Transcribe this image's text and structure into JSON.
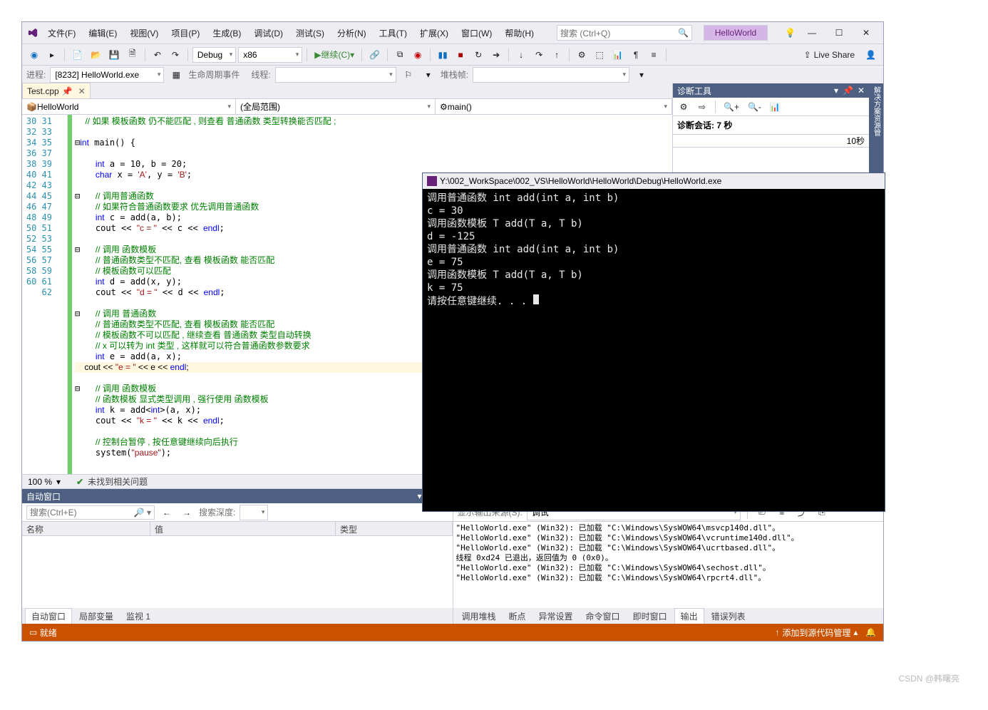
{
  "title": {
    "solution": "HelloWorld"
  },
  "menu": {
    "file": "文件(F)",
    "edit": "编辑(E)",
    "view": "视图(V)",
    "project": "项目(P)",
    "build": "生成(B)",
    "debug": "调试(D)",
    "test": "测试(S)",
    "analyze": "分析(N)",
    "tools": "工具(T)",
    "extensions": "扩展(X)",
    "window": "窗口(W)",
    "help": "帮助(H)"
  },
  "search": {
    "placeholder": "搜索 (Ctrl+Q)"
  },
  "toolbar": {
    "config": "Debug",
    "platform": "x86",
    "continue": "继续(C)",
    "liveshare": "Live Share"
  },
  "toolbar2": {
    "process_lbl": "进程:",
    "process_val": "[8232] HelloWorld.exe",
    "lifecycle": "生命周期事件",
    "thread": "线程:",
    "stackframe": "堆栈帧:"
  },
  "file_tab": "Test.cpp",
  "nav": {
    "project": "HelloWorld",
    "scope": "(全局范围)",
    "func": "main()"
  },
  "gutter": {
    "start": 30,
    "end": 62
  },
  "zoom": {
    "value": "100 %",
    "issues": "未找到相关问题"
  },
  "diag": {
    "title": "诊断工具",
    "session": "诊断会话: 7 秒",
    "tick": "10秒"
  },
  "rightvert": "解决方案资源管",
  "auto": {
    "title": "自动窗口",
    "search_ph": "搜索(Ctrl+E)",
    "depth_lbl": "搜索深度:",
    "col_name": "名称",
    "col_val": "值",
    "col_type": "类型"
  },
  "auto_tabs": {
    "auto": "自动窗口",
    "locals": "局部变量",
    "watch": "监视 1"
  },
  "output": {
    "title": "输出",
    "src_lbl": "显示输出来源(S):",
    "src_val": "调试",
    "lines": [
      "\"HelloWorld.exe\" (Win32): 已加载 \"C:\\Windows\\SysWOW64\\msvcp140d.dll\"。",
      "\"HelloWorld.exe\" (Win32): 已加载 \"C:\\Windows\\SysWOW64\\vcruntime140d.dll\"。",
      "\"HelloWorld.exe\" (Win32): 已加载 \"C:\\Windows\\SysWOW64\\ucrtbased.dll\"。",
      "线程 0xd24 已退出，返回值为 0 (0x0)。",
      "\"HelloWorld.exe\" (Win32): 已加载 \"C:\\Windows\\SysWOW64\\sechost.dll\"。",
      "\"HelloWorld.exe\" (Win32): 已加载 \"C:\\Windows\\SysWOW64\\rpcrt4.dll\"。"
    ]
  },
  "out_tabs": {
    "callstack": "调用堆栈",
    "bp": "断点",
    "ex": "异常设置",
    "cmd": "命令窗口",
    "imm": "即时窗口",
    "out": "输出",
    "err": "错误列表"
  },
  "status": {
    "left": "就绪",
    "right": "添加到源代码管理"
  },
  "console": {
    "title": "Y:\\002_WorkSpace\\002_VS\\HelloWorld\\HelloWorld\\Debug\\HelloWorld.exe",
    "lines": [
      "调用普通函数 int add(int a, int b)",
      "c = 30",
      "调用函数模板 T add(T a, T b)",
      "d = -125",
      "调用普通函数 int add(int a, int b)",
      "e = 75",
      "调用函数模板 T add(T a, T b)",
      "k = 75",
      "请按任意键继续. . . "
    ]
  },
  "watermark": "CSDN @韩曙亮"
}
